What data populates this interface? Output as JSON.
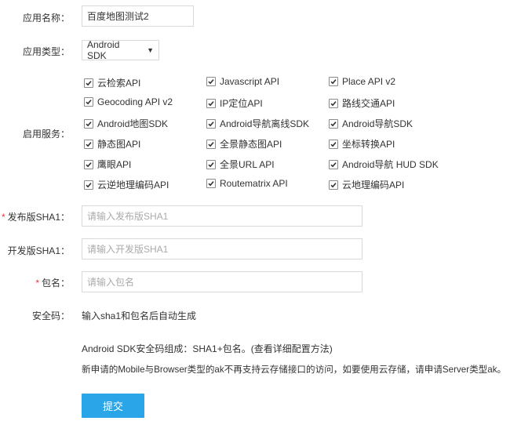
{
  "form": {
    "app_name": {
      "label": "应用名称：",
      "value": "百度地图测试2"
    },
    "app_type": {
      "label": "应用类型：",
      "selected": "Android SDK"
    },
    "services": {
      "label": "启用服务：",
      "items": [
        [
          "云检索API",
          "Javascript API",
          "Place API v2"
        ],
        [
          "Geocoding API v2",
          "IP定位API",
          "路线交通API"
        ],
        [
          "Android地图SDK",
          "Android导航离线SDK",
          "Android导航SDK"
        ],
        [
          "静态图API",
          "全景静态图API",
          "坐标转换API"
        ],
        [
          "鹰眼API",
          "全景URL API",
          "Android导航 HUD SDK"
        ],
        [
          "云逆地理编码API",
          "Routematrix API",
          "云地理编码API"
        ]
      ]
    },
    "release_sha1": {
      "required_mark": "*",
      "label": "发布版SHA1：",
      "placeholder": "请输入发布版SHA1"
    },
    "dev_sha1": {
      "label": "开发版SHA1：",
      "placeholder": "请输入开发版SHA1"
    },
    "package": {
      "required_mark": "*",
      "label": "包名：",
      "placeholder": "请输入包名"
    },
    "security_code": {
      "label": "安全码：",
      "value": "输入sha1和包名后自动生成"
    },
    "note_sdk": "Android SDK安全码组成：SHA1+包名。(查看详细配置方法)",
    "note_storage": "新申请的Mobile与Browser类型的ak不再支持云存储接口的访问，如要使用云存储，请申请Server类型ak。",
    "submit_label": "提交"
  },
  "colors": {
    "submit_bg": "#2aa6e8",
    "required": "#e4393c",
    "placeholder": "#aaaaaa"
  }
}
